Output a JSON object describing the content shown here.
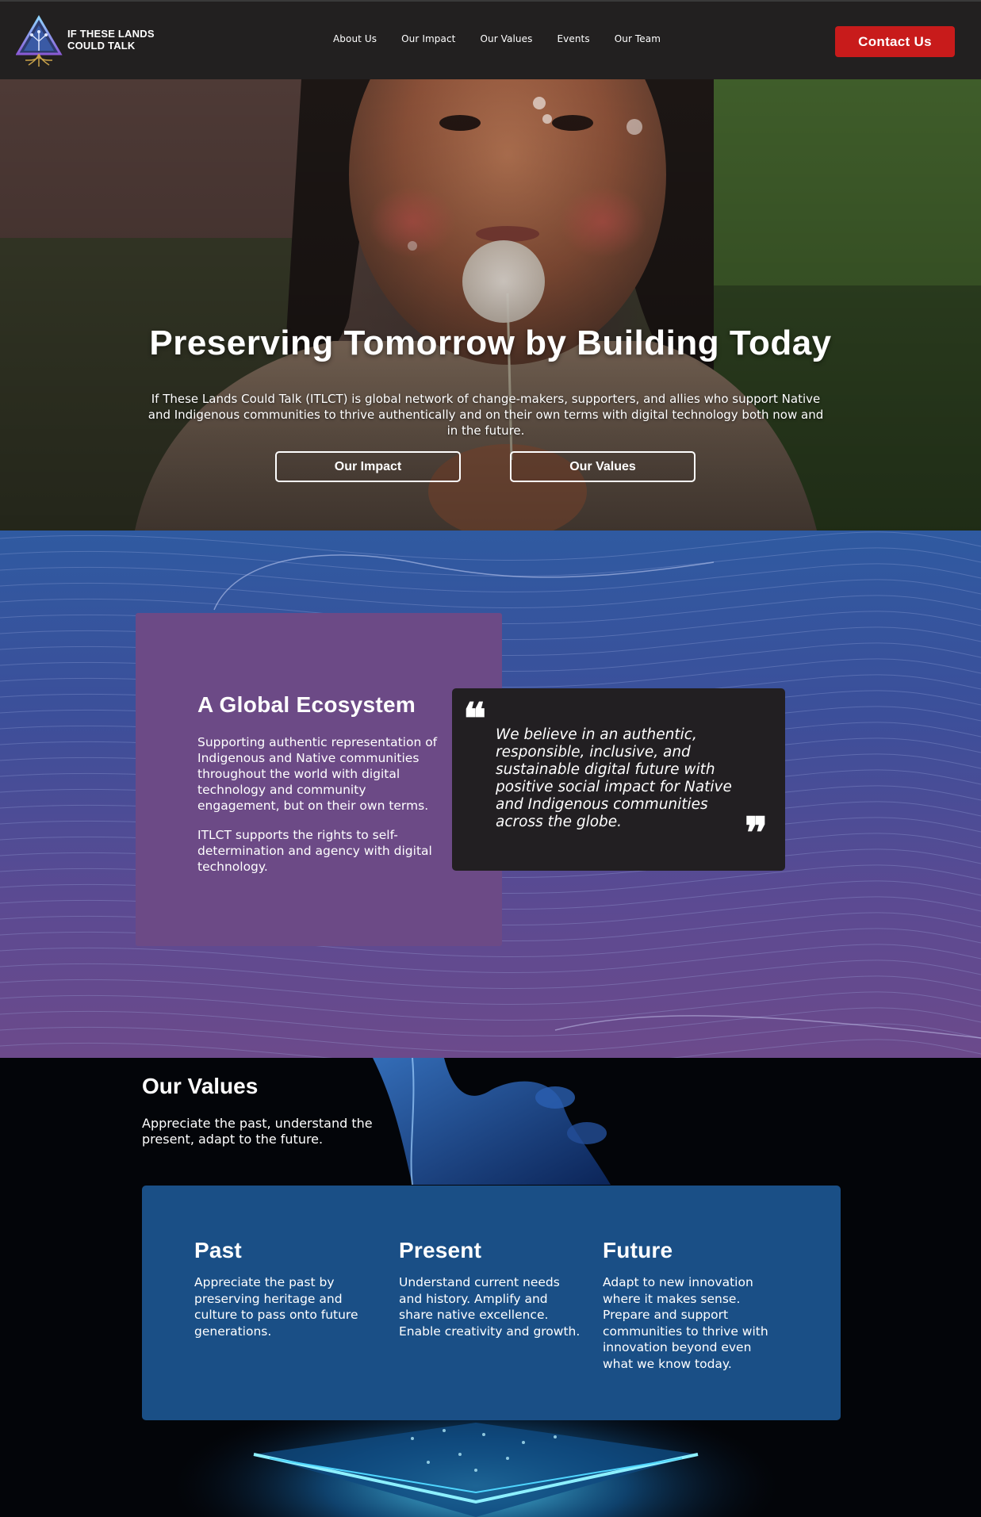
{
  "nav": {
    "logo_text": "IF THESE LANDS\nCOULD TALK",
    "menu": [
      {
        "label": "About Us"
      },
      {
        "label": "Our Impact"
      },
      {
        "label": "Our Values"
      },
      {
        "label": "Events"
      },
      {
        "label": "Our Team"
      }
    ],
    "contact_label": "Contact Us"
  },
  "hero": {
    "title": "Preserving Tomorrow by Building Today",
    "subtitle": "If These Lands Could Talk (ITLCT) is global network of change-makers, supporters, and allies who support Native and Indigenous communities to thrive authentically and on their own terms with digital technology both now and in the future.",
    "buttons": [
      {
        "label": "Our Impact"
      },
      {
        "label": "Our Values"
      }
    ]
  },
  "ecosystem": {
    "title": "A Global Ecosystem",
    "paragraphs": [
      "Supporting authentic representation of Indigenous and Native communities throughout the world with digital technology and community engagement, but on their own terms.",
      "ITLCT supports the rights to self-determination and agency with digital technology."
    ],
    "quote": "We believe in an authentic, responsible, inclusive, and sustainable digital future with positive social impact for Native and Indigenous communities across the globe."
  },
  "values": {
    "title": "Our Values",
    "subtitle": "Appreciate the past, understand the present, adapt to the future.",
    "columns": [
      {
        "title": "Past",
        "text": "Appreciate the past by preserving heritage and culture to pass onto future generations."
      },
      {
        "title": "Present",
        "text": "Understand current needs and history. Amplify and share native excellence. Enable creativity and growth."
      },
      {
        "title": "Future",
        "text": "Adapt to new innovation where it makes sense. Prepare and support communities to thrive with innovation beyond even what we know today."
      }
    ]
  },
  "colors": {
    "nav_bg": "#222020",
    "contact_red": "#c81b1b",
    "eco_card": "#6c4a86",
    "quote_card": "#221f22",
    "values_card": "#1a4f86"
  }
}
